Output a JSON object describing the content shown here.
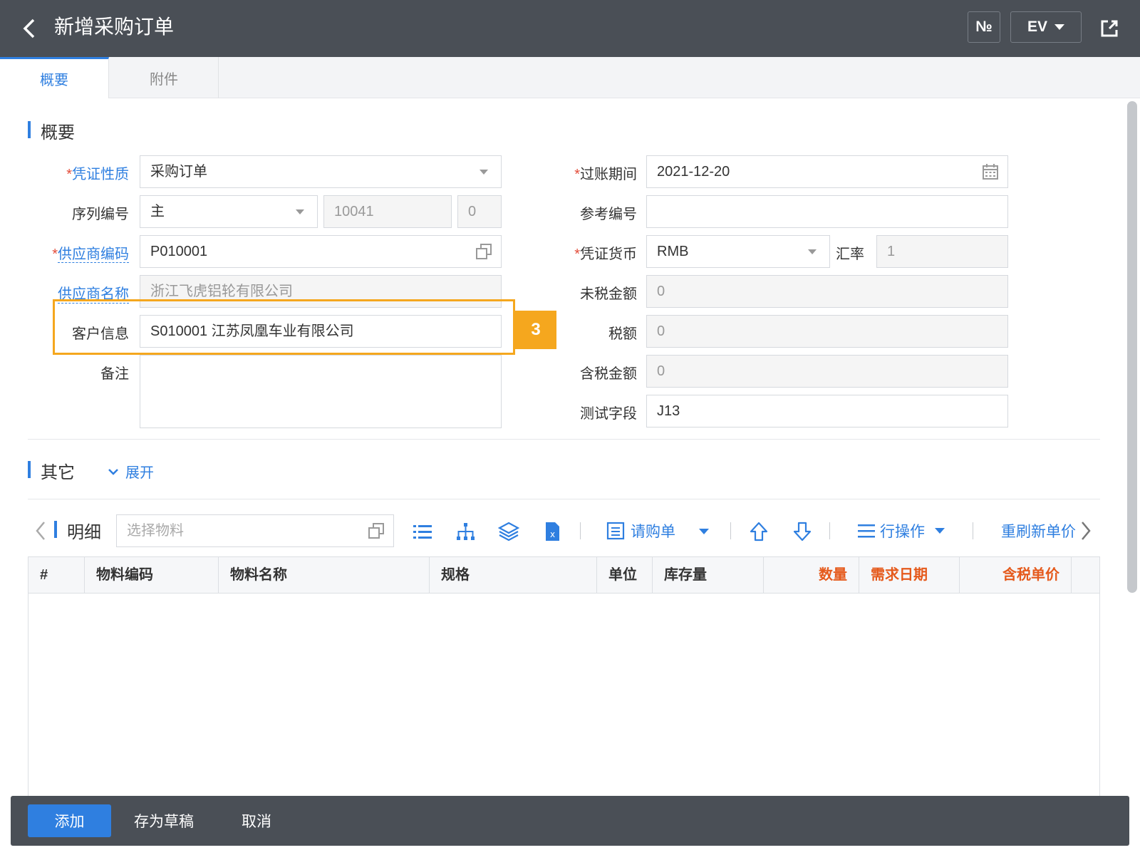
{
  "header": {
    "title": "新增采购订单",
    "number_button": "№",
    "lang_button": "EV"
  },
  "tabs": [
    {
      "label": "概要",
      "active": true
    },
    {
      "label": "附件",
      "active": false
    }
  ],
  "summary": {
    "section_title": "概要",
    "voucher_type": {
      "label": "凭证性质",
      "value": "采购订单"
    },
    "series_no": {
      "label": "序列编号",
      "value": "主",
      "number": "10041",
      "suffix": "0"
    },
    "supplier_code": {
      "label": "供应商编码",
      "value": "P010001"
    },
    "supplier_name": {
      "label": "供应商名称",
      "value": "浙江飞虎铝轮有限公司"
    },
    "customer_info": {
      "label": "客户信息",
      "value": "S010001 江苏凤凰车业有限公司"
    },
    "remark": {
      "label": "备注",
      "value": ""
    },
    "posting_date": {
      "label": "过账期间",
      "value": "2021-12-20"
    },
    "reference_no": {
      "label": "参考编号",
      "value": ""
    },
    "currency": {
      "label": "凭证货币",
      "value": "RMB"
    },
    "exchange_rate": {
      "label": "汇率",
      "value": "1"
    },
    "pre_tax_amount": {
      "label": "未税金额",
      "value": "0"
    },
    "tax_amount": {
      "label": "税额",
      "value": "0"
    },
    "tax_incl_amount": {
      "label": "含税金额",
      "value": "0"
    },
    "test_field": {
      "label": "测试字段",
      "value": "J13"
    }
  },
  "annotation": {
    "step": "3"
  },
  "other": {
    "section_title": "其它",
    "expand_label": "展开"
  },
  "detail": {
    "title": "明细",
    "search_placeholder": "选择物料",
    "purchase_request": "请购单",
    "row_ops": "行操作",
    "refresh_price": "重刷新单价",
    "columns": [
      {
        "label": "#",
        "required": false
      },
      {
        "label": "物料编码",
        "required": false
      },
      {
        "label": "物料名称",
        "required": false
      },
      {
        "label": "规格",
        "required": false
      },
      {
        "label": "单位",
        "required": false
      },
      {
        "label": "库存量",
        "required": false
      },
      {
        "label": "数量",
        "required": true
      },
      {
        "label": "需求日期",
        "required": true
      },
      {
        "label": "含税单价",
        "required": true
      }
    ]
  },
  "footer": {
    "add": "添加",
    "save_draft": "存为草稿",
    "cancel": "取消"
  },
  "colors": {
    "header_bg": "#4a4f56",
    "accent": "#2f7fe0",
    "highlight": "#f5a71e",
    "required": "#e55a1c"
  }
}
